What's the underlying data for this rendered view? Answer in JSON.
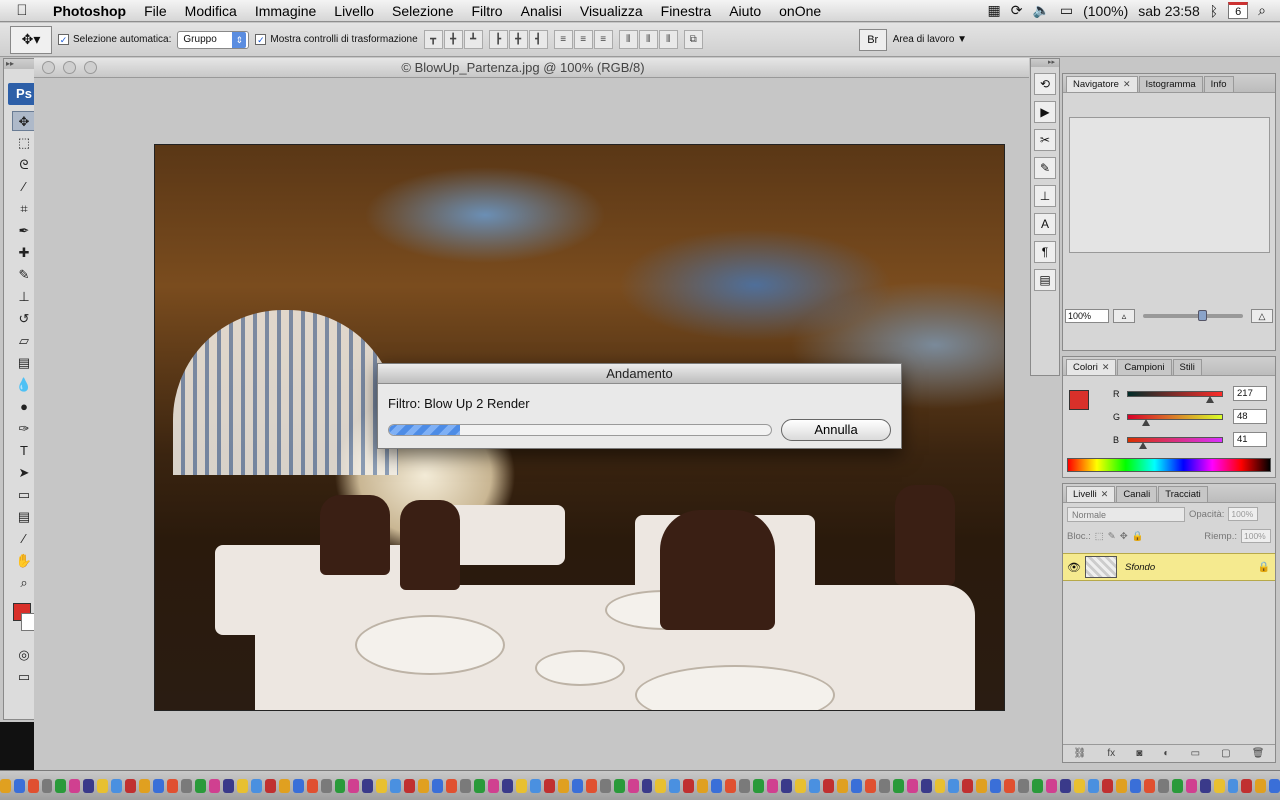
{
  "menubar": {
    "app": "Photoshop",
    "items": [
      "File",
      "Modifica",
      "Immagine",
      "Livello",
      "Selezione",
      "Filtro",
      "Analisi",
      "Visualizza",
      "Finestra",
      "Aiuto",
      "onOne"
    ],
    "battery": "(100%)",
    "clock": "sab 23:58",
    "calendar_day": "6"
  },
  "options": {
    "auto_select_label": "Selezione automatica:",
    "auto_select_value": "Gruppo",
    "transform_label": "Mostra controlli di trasformazione",
    "workspace_label": "Area di lavoro ▼"
  },
  "document": {
    "title": "© BlowUp_Partenza.jpg @ 100% (RGB/8)"
  },
  "toolbox": {
    "logo": "Ps"
  },
  "navigator": {
    "tabs": [
      "Navigatore",
      "Istogramma",
      "Info"
    ],
    "zoom": "100%"
  },
  "color_panel": {
    "tabs": [
      "Colori",
      "Campioni",
      "Stili"
    ],
    "channels": [
      {
        "label": "R",
        "value": "217",
        "fraction": 0.85,
        "gradient": "linear-gradient(90deg,#002c29,#ff2c29)"
      },
      {
        "label": "G",
        "value": "48",
        "fraction": 0.19,
        "gradient": "linear-gradient(90deg,#d90029,#d9ff29)"
      },
      {
        "label": "B",
        "value": "41",
        "fraction": 0.16,
        "gradient": "linear-gradient(90deg,#d93000,#d930ff)"
      }
    ],
    "foreground": "#d9302a"
  },
  "layers_panel": {
    "tabs": [
      "Livelli",
      "Canali",
      "Tracciati"
    ],
    "blend_mode": "Normale",
    "opacity_label": "Opacità:",
    "opacity_value": "100%",
    "lock_label": "Bloc.:",
    "fill_label": "Riemp.:",
    "fill_value": "100%",
    "layer_name": "Sfondo"
  },
  "dialog": {
    "title": "Andamento",
    "message": "Filtro: Blow Up 2 Render",
    "progress": 0.185,
    "cancel_label": "Annulla"
  }
}
